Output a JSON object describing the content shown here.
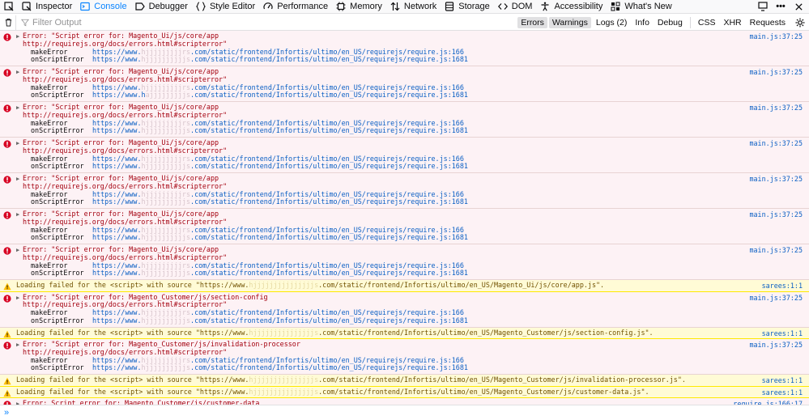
{
  "toolbar": {
    "tabs": [
      {
        "label": "Inspector",
        "icon": "inspector-icon"
      },
      {
        "label": "Console",
        "icon": "console-icon",
        "active": true
      },
      {
        "label": "Debugger",
        "icon": "debugger-icon"
      },
      {
        "label": "Style Editor",
        "icon": "style-editor-icon"
      },
      {
        "label": "Performance",
        "icon": "performance-icon"
      },
      {
        "label": "Memory",
        "icon": "memory-icon"
      },
      {
        "label": "Network",
        "icon": "network-icon"
      },
      {
        "label": "Storage",
        "icon": "storage-icon"
      },
      {
        "label": "DOM",
        "icon": "dom-icon"
      },
      {
        "label": "Accessibility",
        "icon": "accessibility-icon"
      },
      {
        "label": "What's New",
        "icon": "whats-new-icon"
      }
    ]
  },
  "filter": {
    "placeholder": "Filter Output",
    "buttons": [
      "Errors",
      "Warnings",
      "Logs (2)",
      "Info",
      "Debug",
      "CSS",
      "XHR",
      "Requests"
    ],
    "active_buttons": [
      "Errors",
      "Warnings"
    ]
  },
  "messages": [
    {
      "type": "error",
      "title": "Error: \"Script error for: Magento_Ui/js/core/app",
      "link": "http://requirejs.org/docs/errors.html#scripterror\"",
      "source": "main.js:37:25",
      "frames": [
        {
          "fn": "makeError",
          "pre": "https://www.",
          "mask": "hjjjjjjjjjrs",
          "post": ".com/static/frontend/Infortis/ultimo/en_US/requirejs/require.js:166"
        },
        {
          "fn": "onScriptError",
          "pre": "https://www.",
          "mask": "hjjjjjjjjjjs",
          "post": ".com/static/frontend/Infortis/ultimo/en_US/requirejs/require.js:1681"
        }
      ]
    },
    {
      "type": "error",
      "title": "Error: \"Script error for: Magento_Ui/js/core/app",
      "link": "http://requirejs.org/docs/errors.html#scripterror\"",
      "source": "main.js:37:25",
      "frames": [
        {
          "fn": "makeError",
          "pre": "https://www.",
          "mask": "hjjjjjjjjjrs",
          "post": ".com/static/frontend/Infortis/ultimo/en_US/requirejs/require.js:166"
        },
        {
          "fn": "onScriptError",
          "pre": "https://www.h",
          "mask": "ajjjjjjjjjs",
          "post": ".com/static/frontend/Infortis/ultimo/en_US/requirejs/require.js:1681"
        }
      ]
    },
    {
      "type": "error",
      "title": "Error: \"Script error for: Magento_Ui/js/core/app",
      "link": "http://requirejs.org/docs/errors.html#scripterror\"",
      "source": "main.js:37:25",
      "frames": [
        {
          "fn": "makeError",
          "pre": "https://www.",
          "mask": "hjjjjjjjjjrs",
          "post": ".com/static/frontend/Infortis/ultimo/en_US/requirejs/require.js:166"
        },
        {
          "fn": "onScriptError",
          "pre": "https://www.",
          "mask": "hjjjjjjjjjjs",
          "post": ".com/static/frontend/Infortis/ultimo/en_US/requirejs/require.js:1681"
        }
      ]
    },
    {
      "type": "error",
      "title": "Error: \"Script error for: Magento_Ui/js/core/app",
      "link": "http://requirejs.org/docs/errors.html#scripterror\"",
      "source": "main.js:37:25",
      "frames": [
        {
          "fn": "makeError",
          "pre": "https://www.",
          "mask": "hjjjjjjjjjrs",
          "post": ".com/static/frontend/Infortis/ultimo/en_US/requirejs/require.js:166"
        },
        {
          "fn": "onScriptError",
          "pre": "https://www.",
          "mask": "hjjjjjjjjjjs",
          "post": ".com/static/frontend/Infortis/ultimo/en_US/requirejs/require.js:1681"
        }
      ]
    },
    {
      "type": "error",
      "title": "Error: \"Script error for: Magento_Ui/js/core/app",
      "link": "http://requirejs.org/docs/errors.html#scripterror\"",
      "source": "main.js:37:25",
      "frames": [
        {
          "fn": "makeError",
          "pre": "https://www.",
          "mask": "hjjjjjjjjjrs",
          "post": ".com/static/frontend/Infortis/ultimo/en_US/requirejs/require.js:166"
        },
        {
          "fn": "onScriptError",
          "pre": "https://www.",
          "mask": "hjjjjjjjjjjs",
          "post": ".com/static/frontend/Infortis/ultimo/en_US/requirejs/require.js:1681"
        }
      ]
    },
    {
      "type": "error",
      "title": "Error: \"Script error for: Magento_Ui/js/core/app",
      "link": "http://requirejs.org/docs/errors.html#scripterror\"",
      "source": "main.js:37:25",
      "frames": [
        {
          "fn": "makeError",
          "pre": "https://www.",
          "mask": "hjjjjjjjjjrs",
          "post": ".com/static/frontend/Infortis/ultimo/en_US/requirejs/require.js:166"
        },
        {
          "fn": "onScriptError",
          "pre": "https://www.",
          "mask": "hjjjjjjjjjjs",
          "post": ".com/static/frontend/Infortis/ultimo/en_US/requirejs/require.js:1681"
        }
      ]
    },
    {
      "type": "error",
      "title": "Error: \"Script error for: Magento_Ui/js/core/app",
      "link": "http://requirejs.org/docs/errors.html#scripterror\"",
      "source": "main.js:37:25",
      "frames": [
        {
          "fn": "makeError",
          "pre": "https://www.",
          "mask": "hjjjjjjjjjrs",
          "post": ".com/static/frontend/Infortis/ultimo/en_US/requirejs/require.js:166"
        },
        {
          "fn": "onScriptError",
          "pre": "https://www.",
          "mask": "hjjjjjjjjjjs",
          "post": ".com/static/frontend/Infortis/ultimo/en_US/requirejs/require.js:1681"
        }
      ]
    },
    {
      "type": "warn",
      "pre": "Loading failed for the <script> with source \"https://www.",
      "mask": "hjjjjjjjjjjjjjjjs",
      "post": ".com/static/frontend/Infortis/ultimo/en_US/Magento_Ui/js/core/app.js\".",
      "source": "sarees:1:1"
    },
    {
      "type": "error",
      "title": "Error: \"Script error for: Magento_Customer/js/section-config",
      "link": "http://requirejs.org/docs/errors.html#scripterror\"",
      "source": "main.js:37:25",
      "frames": [
        {
          "fn": "makeError",
          "pre": "https://www.",
          "mask": "hjjjjjjjjjrs",
          "post": ".com/static/frontend/Infortis/ultimo/en_US/requirejs/require.js:166"
        },
        {
          "fn": "onScriptError",
          "pre": "https://www.",
          "mask": "hjjjjjjjjjjs",
          "post": ".com/static/frontend/Infortis/ultimo/en_US/requirejs/require.js:1681"
        }
      ]
    },
    {
      "type": "warn",
      "pre": "Loading failed for the <script> with source \"https://www.",
      "mask": "hjjjjjjjjjjjjjjjs",
      "post": ".com/static/frontend/Infortis/ultimo/en_US/Magento_Customer/js/section-config.js\".",
      "source": "sarees:1:1"
    },
    {
      "type": "error",
      "title": "Error: \"Script error for: Magento_Customer/js/invalidation-processor",
      "link": "http://requirejs.org/docs/errors.html#scripterror\"",
      "source": "main.js:37:25",
      "frames": [
        {
          "fn": "makeError",
          "pre": "https://www.",
          "mask": "hjjjjjjjjjrs",
          "post": ".com/static/frontend/Infortis/ultimo/en_US/requirejs/require.js:166"
        },
        {
          "fn": "onScriptError",
          "pre": "https://www.",
          "mask": "hjjjjjjjjjjs",
          "post": ".com/static/frontend/Infortis/ultimo/en_US/requirejs/require.js:1681"
        }
      ]
    },
    {
      "type": "warn",
      "pre": "Loading failed for the <script> with source \"https://www.",
      "mask": "hjjjjjjjjjjjjjjjs",
      "post": ".com/static/frontend/Infortis/ultimo/en_US/Magento_Customer/js/invalidation-processor.js\".",
      "source": "sarees:1:1"
    },
    {
      "type": "warn",
      "pre": "Loading failed for the <script> with source \"https://www.",
      "mask": "hjjjjjjjjjjjjjjjs",
      "post": ".com/static/frontend/Infortis/ultimo/en_US/Magento_Customer/js/customer-data.js\".",
      "source": "sarees:1:1"
    },
    {
      "type": "error",
      "title": "Error: Script error for: Magento_Customer/js/customer-data",
      "link": "",
      "source": "require.js:166:17",
      "frames": []
    }
  ],
  "prompt": {
    "symbol": "»"
  }
}
